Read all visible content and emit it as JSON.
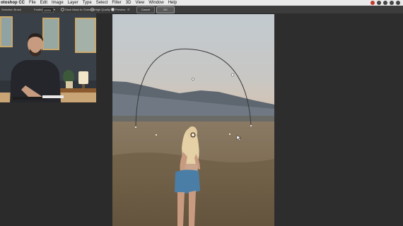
{
  "menubar": {
    "app_name": "otoshop CC",
    "items": [
      "File",
      "Edit",
      "Image",
      "Layer",
      "Type",
      "Select",
      "Filter",
      "3D",
      "View",
      "Window",
      "Help"
    ]
  },
  "options": {
    "tool_label": "Selection Brush",
    "feather_label": "Feather:",
    "feather_value": "100%",
    "mask_channel_label": "Save Mask to Channels",
    "high_quality_label": "High Quality",
    "preview_label": "Preview",
    "cancel_label": "Cancel",
    "ok_label": "OK"
  },
  "colors": {
    "accent": "#3a3a3a",
    "canvas_bg": "#272727"
  }
}
